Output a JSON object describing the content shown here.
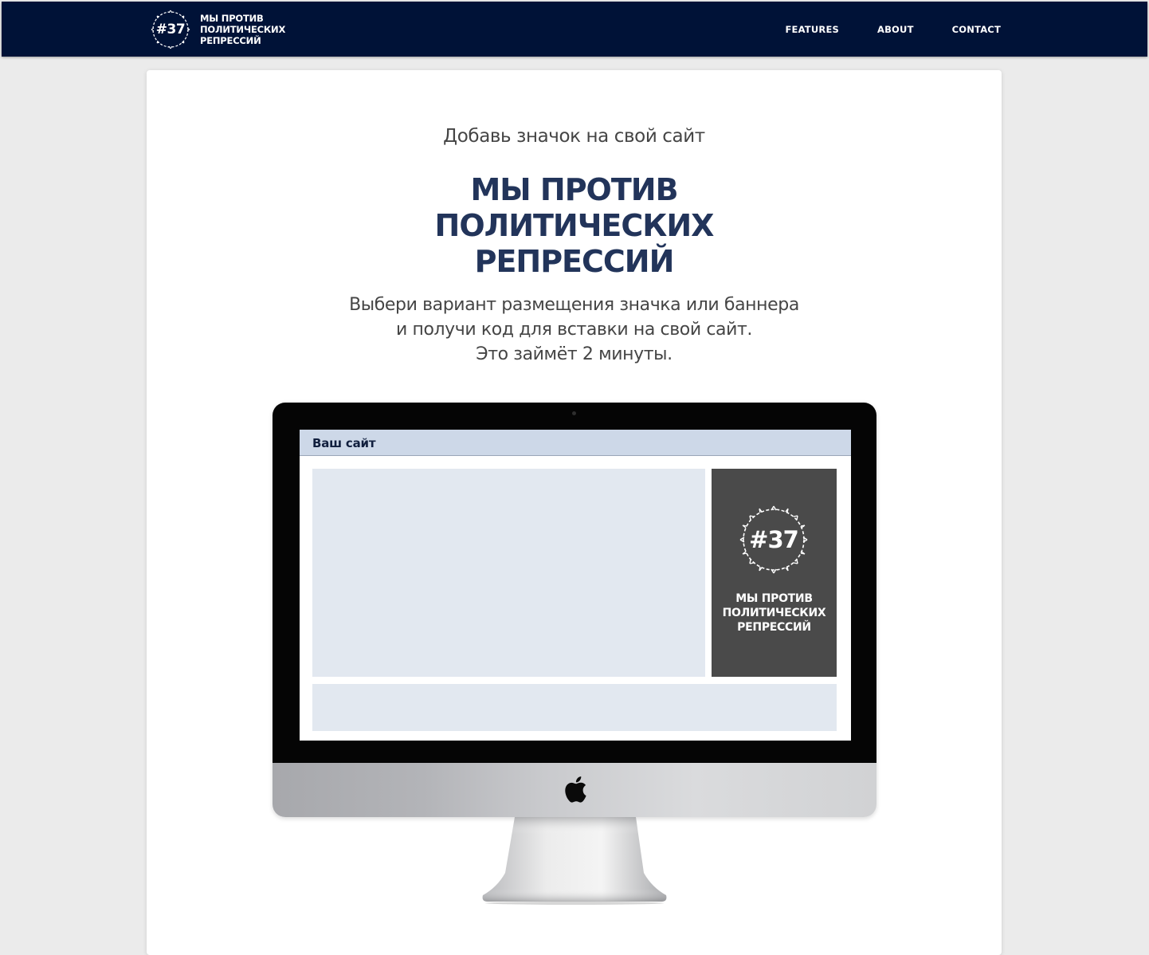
{
  "nav": {
    "brand": {
      "badge": "#37",
      "name_lines": [
        "МЫ ПРОТИВ",
        "ПОЛИТИЧЕСКИХ",
        "РЕПРЕССИЙ"
      ]
    },
    "links": [
      {
        "label": "FEATURES"
      },
      {
        "label": "ABOUT"
      },
      {
        "label": "CONTACT"
      }
    ]
  },
  "hero": {
    "subtitle": "Добавь значок на свой сайт",
    "headline_lines": [
      "МЫ ПРОТИВ",
      "ПОЛИТИЧЕСКИХ",
      "РЕПРЕССИЙ"
    ],
    "description_lines": [
      "Выбери вариант размещения значка или баннера",
      "и получи код для вставки на свой сайт.",
      "Это займёт 2 минуты."
    ]
  },
  "preview": {
    "site_title": "Ваш сайт",
    "banner": {
      "badge": "#37",
      "text_lines": [
        "МЫ ПРОТИВ",
        "ПОЛИТИЧЕСКИХ",
        "РЕПРЕССИЙ"
      ]
    }
  },
  "colors": {
    "navbar_bg": "#001237",
    "headline": "#22345a",
    "page_bg": "#ebebeb",
    "banner_bg": "#4a4a4a",
    "site_header_bg": "#cdd8e8",
    "placeholder_block": "#e2e8f0"
  },
  "icons": {
    "brand_badge": "barbed-wire-wreath-icon",
    "monitor_logo": "apple-logo-icon",
    "banner_badge": "barbed-wire-wreath-icon"
  }
}
